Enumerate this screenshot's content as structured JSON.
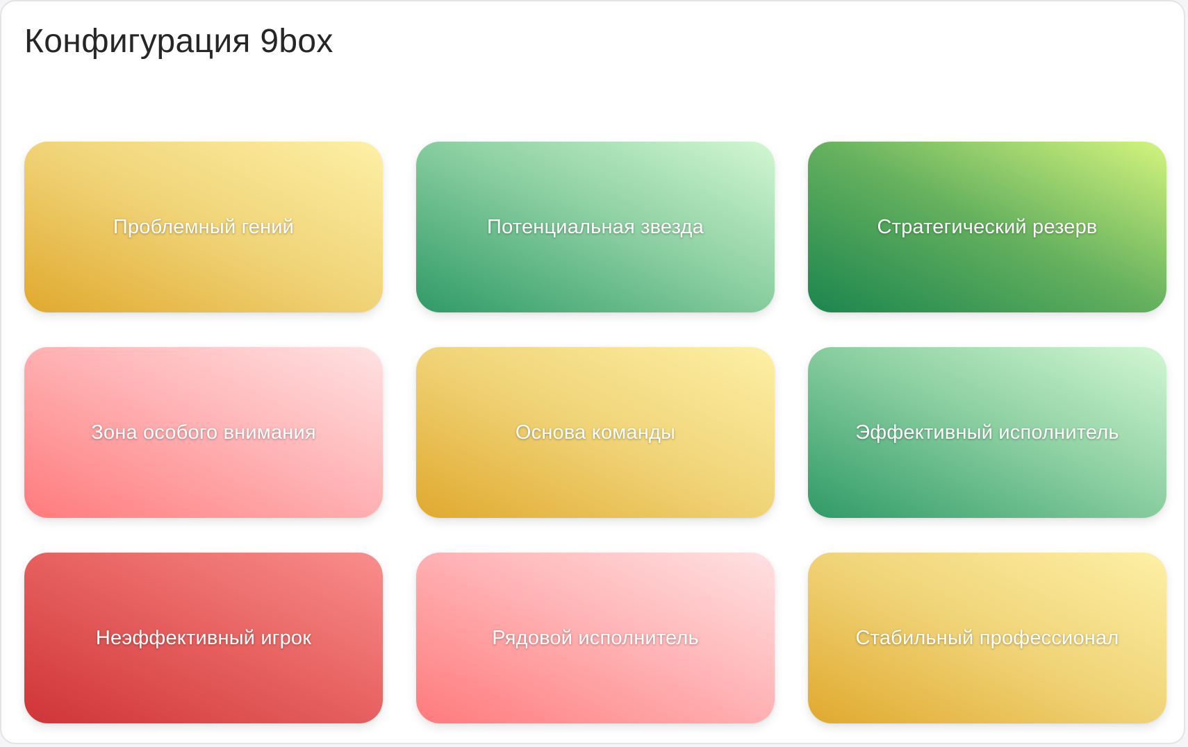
{
  "page": {
    "title": "Конфигурация 9box"
  },
  "colors": {
    "yellow": "#e9c252",
    "teal": "#5fb286",
    "green": "#4aa055",
    "pink": "#ff9c9e",
    "red": "#e0524f"
  },
  "grid": {
    "rows": [
      [
        {
          "label": "Проблемный гений",
          "color": "yellow"
        },
        {
          "label": "Потенциальная звезда",
          "color": "teal"
        },
        {
          "label": "Стратегический резерв",
          "color": "green"
        }
      ],
      [
        {
          "label": "Зона особого внимания",
          "color": "pink"
        },
        {
          "label": "Основа команды",
          "color": "yellow"
        },
        {
          "label": "Эффективный исполнитель",
          "color": "teal"
        }
      ],
      [
        {
          "label": "Неэффективный игрок",
          "color": "red"
        },
        {
          "label": "Рядовой исполнитель",
          "color": "pink"
        },
        {
          "label": "Стабильный профессионал",
          "color": "yellow"
        }
      ]
    ]
  }
}
